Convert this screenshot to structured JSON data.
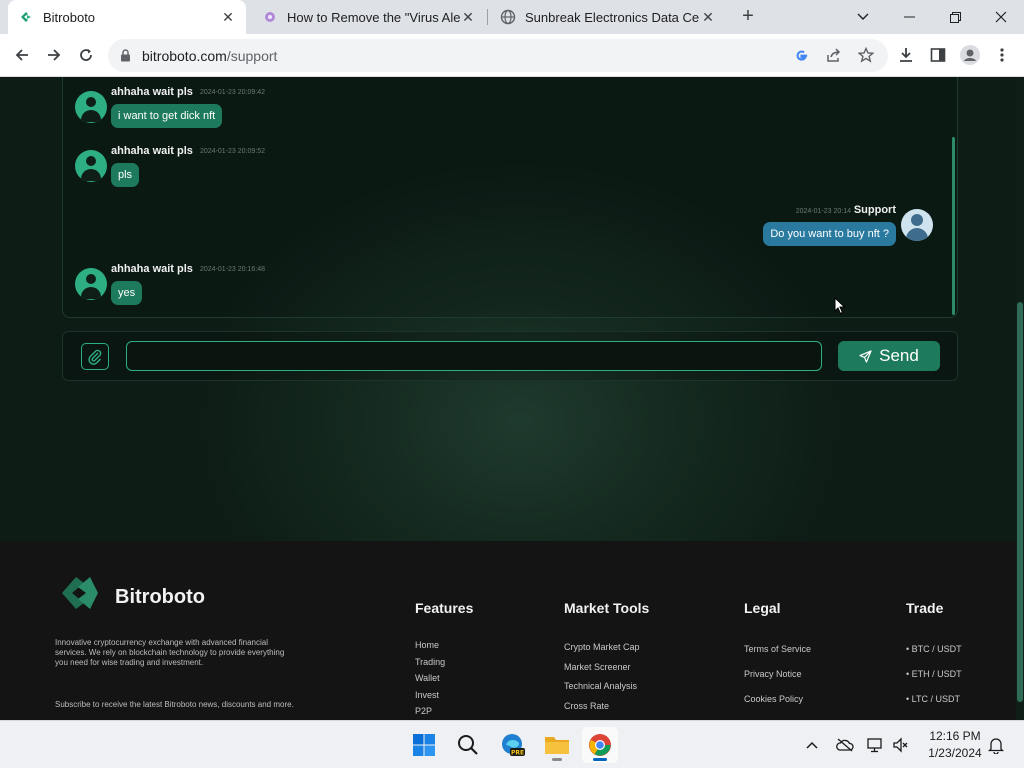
{
  "browser": {
    "tabs": [
      {
        "title": "Bitroboto",
        "icon": "bitroboto-logo-icon",
        "active": true
      },
      {
        "title": "How to Remove the \"Virus Alert f",
        "icon": "spyware-guide-icon",
        "active": false
      },
      {
        "title": "Sunbreak Electronics Data Center",
        "icon": "globe-icon",
        "active": false
      }
    ],
    "url_host": "bitroboto.com",
    "url_path": "/support"
  },
  "chat": {
    "messages": [
      {
        "author": "ahhaha wait pls",
        "time": "2024-01-23 20:09:42",
        "text": "i want to get dick nft",
        "side": "user"
      },
      {
        "author": "ahhaha wait pls",
        "time": "2024-01-23 20:09:52",
        "text": "pls",
        "side": "user"
      },
      {
        "author": "Support",
        "time": "2024-01-23 20:14",
        "text": "Do you want to buy nft ?",
        "side": "support"
      },
      {
        "author": "ahhaha wait pls",
        "time": "2024-01-23 20:16:48",
        "text": "yes",
        "side": "user"
      }
    ],
    "input_value": "",
    "send_label": "Send"
  },
  "footer": {
    "brand": "Bitroboto",
    "about": "Innovative cryptocurrency exchange with advanced financial services. We rely on blockchain technology to provide everything you need for wise trading and investment.",
    "subscribe": "Subscribe to receive the latest Bitroboto news, discounts and more.",
    "columns": [
      {
        "heading": "Features",
        "links": [
          "Home",
          "Trading",
          "Wallet",
          "Invest",
          "P2P"
        ]
      },
      {
        "heading": "Market Tools",
        "links": [
          "Crypto Market Cap",
          "Market Screener",
          "Technical Analysis",
          "Cross Rate"
        ]
      },
      {
        "heading": "Legal",
        "links": [
          "Terms of Service",
          "Privacy Notice",
          "Cookies Policy"
        ]
      },
      {
        "heading": "Trade",
        "links": [
          "• BTC / USDT",
          "• ETH / USDT",
          "• LTC / USDT"
        ]
      }
    ]
  },
  "taskbar": {
    "apps": [
      "start-icon",
      "search-icon",
      "edge-pre-icon",
      "file-explorer-icon",
      "chrome-icon"
    ],
    "time": "12:16 PM",
    "date": "1/23/2024"
  },
  "colors": {
    "accent": "#2eaf83",
    "bubble_user": "#1e7a5c",
    "bubble_support": "#2a7aa0",
    "footer_bg": "#141414"
  }
}
